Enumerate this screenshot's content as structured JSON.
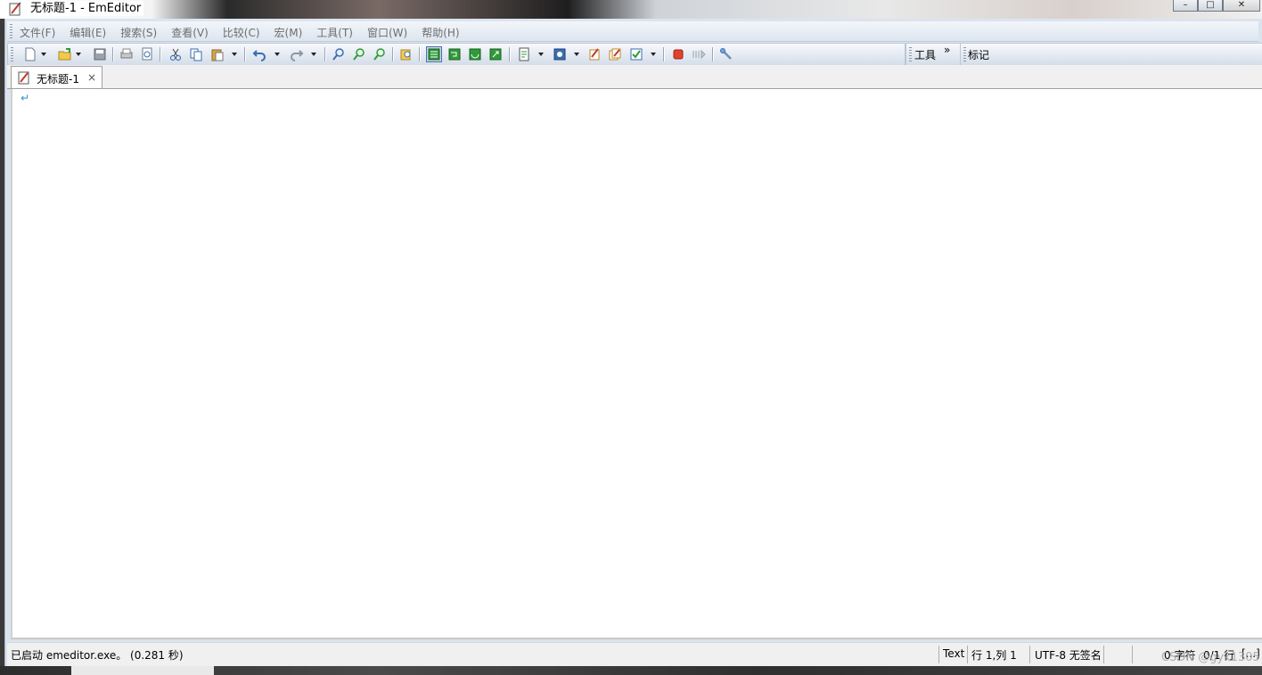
{
  "window": {
    "title": "无标题-1 - EmEditor",
    "controls": {
      "minimize": "–",
      "maximize": "□",
      "close": "✕"
    }
  },
  "menu": {
    "items": [
      "文件(F)",
      "编辑(E)",
      "搜索(S)",
      "查看(V)",
      "比较(C)",
      "宏(M)",
      "工具(T)",
      "窗口(W)",
      "帮助(H)"
    ]
  },
  "toolbar": {
    "icons": [
      "new-file-icon",
      "open-folder-icon",
      "save-icon",
      "print-icon",
      "print-preview-icon",
      "cut-icon",
      "copy-icon",
      "paste-icon",
      "undo-icon",
      "redo-icon",
      "find-icon",
      "find-next-icon",
      "find-prev-icon",
      "find-in-files-icon",
      "view-mode-icon",
      "wrap-icon",
      "wrap-window-icon",
      "wrap-page-icon",
      "encoding-icon",
      "configuration-icon",
      "macro-record-icon",
      "macro-run-icon",
      "checkbox-icon",
      "stop-icon",
      "run-icon",
      "tools-icon"
    ]
  },
  "tools_toolbar": {
    "label": "工具",
    "overflow": "»"
  },
  "markers_toolbar": {
    "label": "标记"
  },
  "tab": {
    "label": "无标题-1",
    "close": "×"
  },
  "editor": {
    "eol_mark": "↵"
  },
  "status": {
    "message": "已启动 emeditor.exe。 (0.281 秒)",
    "mode": "Text",
    "position": "行 1,列 1",
    "encoding": "UTF-8 无签名",
    "chars": "0 字符",
    "lines": "0/1 行",
    "extra": "[...]"
  },
  "watermark": "CSDN @gyk1305",
  "colors": {
    "accent": "#4a6fa8",
    "frame": "#dbe3ee",
    "eol": "#3a8fc8"
  }
}
